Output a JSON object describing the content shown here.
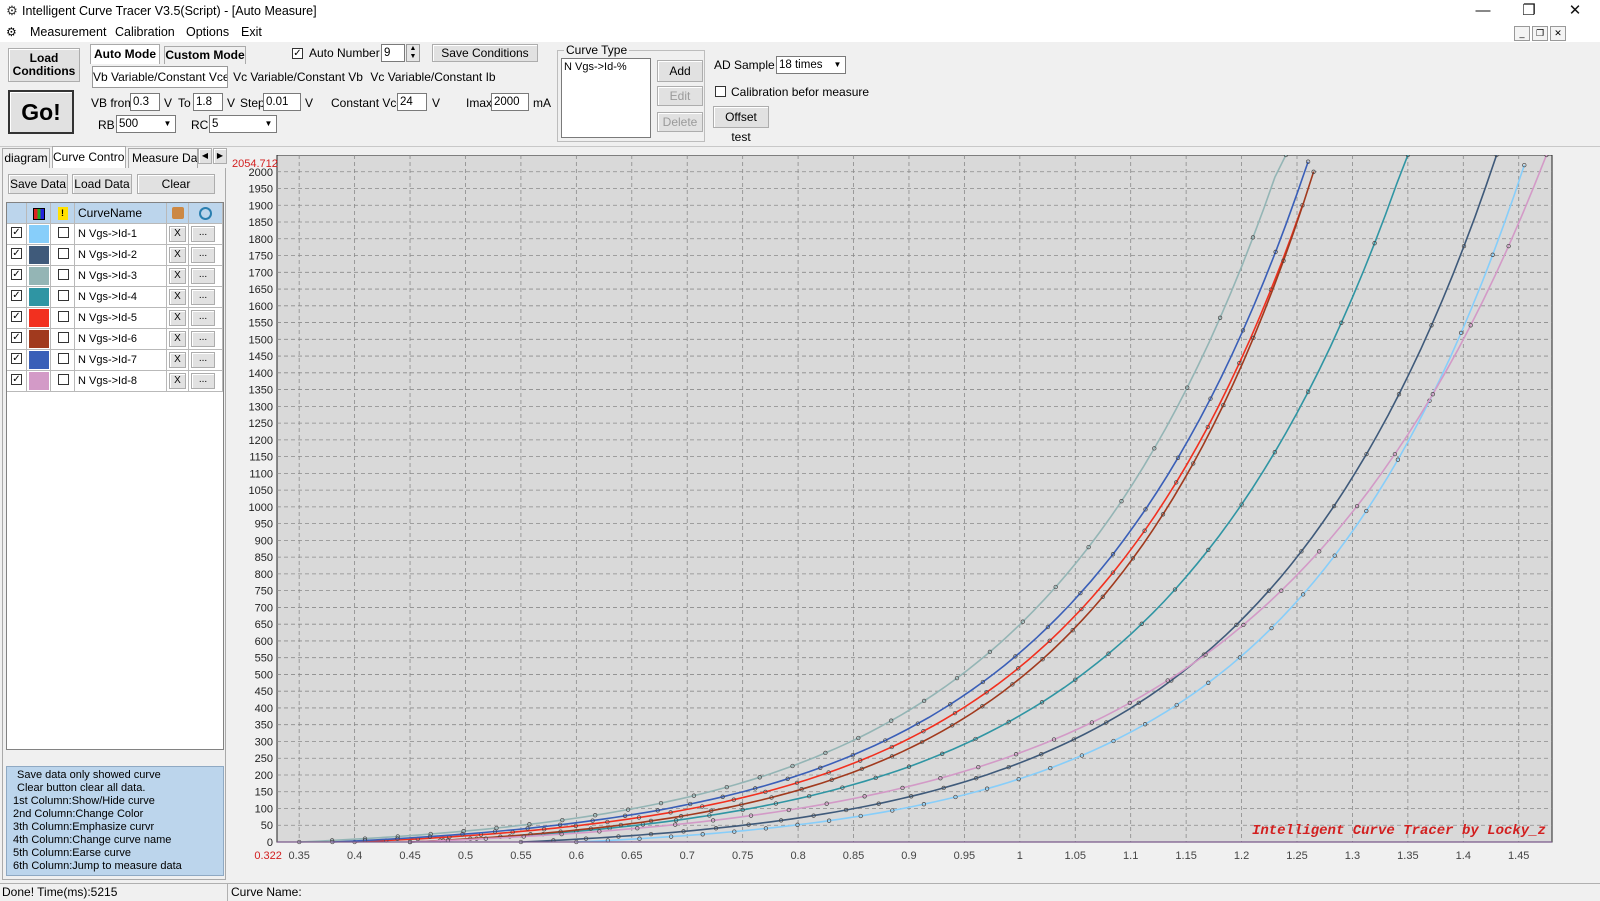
{
  "window": {
    "title": "Intelligent Curve Tracer V3.5(Script) - [Auto Measure]",
    "controls": [
      "—",
      "❐",
      "✕"
    ]
  },
  "menu": [
    "Measurement",
    "Calibration",
    "Options",
    "Exit"
  ],
  "toolbar": {
    "load_conditions": "Load Conditions",
    "go": "Go!",
    "mode_tabs": [
      "Auto Mode",
      "Custom Mode"
    ],
    "auto_number_label": "Auto Number",
    "auto_number_checked": true,
    "auto_number_value": "9",
    "save_conditions": "Save Conditions",
    "sweep_tabs": [
      "Vb Variable/Constant Vce",
      "Vc Variable/Constant Vb",
      "Vc Variable/Constant Ib"
    ],
    "vb_from_label": "VB from",
    "vb_from_value": "0.3",
    "v_unit": "V",
    "to_label": "To",
    "to_value": "1.8",
    "step_label": "Step",
    "step_value": "0.01",
    "constant_vce_label": "Constant Vce",
    "constant_vce_value": "24",
    "imax_label": "Imax",
    "imax_value": "2000",
    "ma_unit": "mA",
    "rb_label": "RB",
    "rb_value": "500",
    "rc_label": "RC",
    "rc_value": "5",
    "curve_type_label": "Curve Type",
    "curve_type_item": "N Vgs->Id-%",
    "add": "Add",
    "edit": "Edit",
    "delete": "Delete",
    "ad_sample_label": "AD Sample",
    "ad_sample_value": "18 times",
    "calibration_label": "Calibration befor measure",
    "calibration_checked": false,
    "offset_test": "Offset test"
  },
  "left_panel": {
    "tabs": [
      "diagram",
      "Curve Control",
      "Measure Data"
    ],
    "tab_arrows": [
      "◀",
      "▶"
    ],
    "save_data": "Save Data",
    "load_data": "Load Data",
    "clear": "Clear",
    "column_header": "CurveName",
    "delete_symbol": "X",
    "more_symbol": "...",
    "curves": [
      {
        "name": "N Vgs->Id-1",
        "color": "#87cefa",
        "checked": true
      },
      {
        "name": "N Vgs->Id-2",
        "color": "#3f5a7a",
        "checked": true
      },
      {
        "name": "N Vgs->Id-3",
        "color": "#94b5b5",
        "checked": true
      },
      {
        "name": "N Vgs->Id-4",
        "color": "#2f95a3",
        "checked": true
      },
      {
        "name": "N Vgs->Id-5",
        "color": "#f2301f",
        "checked": true
      },
      {
        "name": "N Vgs->Id-6",
        "color": "#a13a1e",
        "checked": true
      },
      {
        "name": "N Vgs->Id-7",
        "color": "#3a5fb8",
        "checked": true
      },
      {
        "name": "N Vgs->Id-8",
        "color": "#d39ac7",
        "checked": true
      }
    ],
    "help": [
      "Save data only showed curve",
      "Clear button clear all data.",
      "1st Column:Show/Hide curve",
      "2nd Column:Change Color",
      "3th Column:Emphasize curvr",
      "4th Column:Change curve name",
      "5th Column:Earse curve",
      "6th Column:Jump to measure data"
    ]
  },
  "chart_data": {
    "type": "line",
    "xlim": [
      0.33,
      1.48
    ],
    "ylim": [
      0,
      2050
    ],
    "grid": true,
    "cursor_readout": "2054.712",
    "cursor_x": "0.322",
    "watermark": "Intelligent Curve Tracer by Locky_z",
    "x_ticks": [
      "0.35",
      "0.4",
      "0.45",
      "0.5",
      "0.55",
      "0.6",
      "0.65",
      "0.7",
      "0.75",
      "0.8",
      "0.85",
      "0.9",
      "0.95",
      "1",
      "1.05",
      "1.1",
      "1.15",
      "1.2",
      "1.25",
      "1.3",
      "1.35",
      "1.4",
      "1.45"
    ],
    "y_ticks": [
      "0",
      "50",
      "100",
      "150",
      "200",
      "250",
      "300",
      "350",
      "400",
      "450",
      "500",
      "550",
      "600",
      "650",
      "700",
      "750",
      "800",
      "850",
      "900",
      "950",
      "1000",
      "1050",
      "1100",
      "1150",
      "1200",
      "1250",
      "1300",
      "1350",
      "1400",
      "1450",
      "1500",
      "1550",
      "1600",
      "1650",
      "1700",
      "1750",
      "1800",
      "1850",
      "1900",
      "1950",
      "2000"
    ],
    "series": [
      {
        "name": "N Vgs->Id-1",
        "color": "#87cefa",
        "start_x": 0.7,
        "end_x": 1.455,
        "end_y": 2020
      },
      {
        "name": "N Vgs->Id-2",
        "color": "#3f5a7a",
        "start_x": 0.65,
        "end_x": 1.43,
        "end_y": 2050
      },
      {
        "name": "N Vgs->Id-3",
        "color": "#94b5b5",
        "start_x": 0.45,
        "end_x": 1.24,
        "end_y": 2080
      },
      {
        "name": "N Vgs->Id-4",
        "color": "#2f95a3",
        "start_x": 0.55,
        "end_x": 1.35,
        "end_y": 2060
      },
      {
        "name": "N Vgs->Id-5",
        "color": "#f2301f",
        "start_x": 0.5,
        "end_x": 1.255,
        "end_y": 1900
      },
      {
        "name": "N Vgs->Id-6",
        "color": "#a13a1e",
        "start_x": 0.55,
        "end_x": 1.265,
        "end_y": 2000
      },
      {
        "name": "N Vgs->Id-7",
        "color": "#3a5fb8",
        "start_x": 0.48,
        "end_x": 1.26,
        "end_y": 2030
      },
      {
        "name": "N Vgs->Id-8",
        "color": "#d39ac7",
        "start_x": 0.55,
        "end_x": 1.475,
        "end_y": 2050
      }
    ]
  },
  "status": {
    "left": "Done!  Time(ms):5215",
    "curve_name_label": "Curve Name:"
  }
}
